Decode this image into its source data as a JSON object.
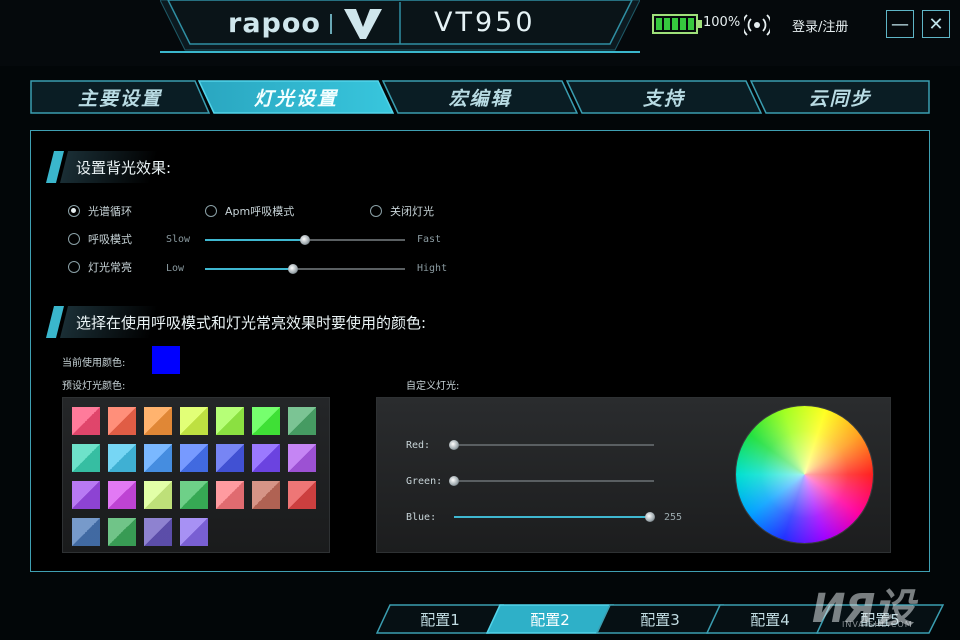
{
  "header": {
    "brand": "rapoo",
    "model": "VT950",
    "battery_text": "100%",
    "battery_level": 1.0,
    "login_label": "登录/注册",
    "min_glyph": "—",
    "close_glyph": "✕"
  },
  "tabs": [
    {
      "label": "主要设置",
      "active": false
    },
    {
      "label": "灯光设置",
      "active": true
    },
    {
      "label": "宏编辑",
      "active": false
    },
    {
      "label": "支持",
      "active": false
    },
    {
      "label": "云同步",
      "active": false
    }
  ],
  "backlight": {
    "title": "设置背光效果:",
    "options": [
      {
        "label": "光谱循环",
        "checked": true
      },
      {
        "label": "Apm呼吸模式",
        "checked": false
      },
      {
        "label": "关闭灯光",
        "checked": false
      },
      {
        "label": "呼吸模式",
        "checked": false
      },
      {
        "label": "灯光常亮",
        "checked": false
      }
    ],
    "speed": {
      "min_label": "Slow",
      "max_label": "Fast",
      "value": 0.5
    },
    "brightness": {
      "min_label": "Low",
      "max_label": "Hight",
      "value": 0.44
    }
  },
  "colors": {
    "title": "选择在使用呼吸模式和灯光常亮效果时要使用的颜色:",
    "current_label": "当前使用颜色:",
    "current_color": "#0000ff",
    "preset_label": "预设灯光颜色:",
    "custom_label": "自定义灯光:",
    "presets": [
      "#ff4f7a",
      "#ff6a4e",
      "#ff9a3e",
      "#d8ff4a",
      "#9eff4a",
      "#48ff3e",
      "#4fb070",
      "#3ed8b8",
      "#48c8f0",
      "#4ea0ff",
      "#4a78ff",
      "#4a5cf0",
      "#7a4cff",
      "#b25cf0",
      "#a04cf0",
      "#d84cf0",
      "#d8ff8a",
      "#3ec060",
      "#ff7a80",
      "#c8705e",
      "#e84848",
      "#4a78b8",
      "#40b060",
      "#6858c0",
      "#8a6cf0"
    ],
    "red": {
      "label": "Red:",
      "value": 0
    },
    "green": {
      "label": "Green:",
      "value": 0
    },
    "blue": {
      "label": "Blue:",
      "value": 255,
      "value_text": "255"
    }
  },
  "profiles": [
    {
      "label": "配置1",
      "active": false
    },
    {
      "label": "配置2",
      "active": true
    },
    {
      "label": "配置3",
      "active": false
    },
    {
      "label": "配置4",
      "active": false
    },
    {
      "label": "配置5",
      "active": false
    }
  ],
  "watermark": {
    "text": "ИЯ设",
    "sub": "INVAISHE.COM"
  },
  "accent": "#3ab6cc"
}
